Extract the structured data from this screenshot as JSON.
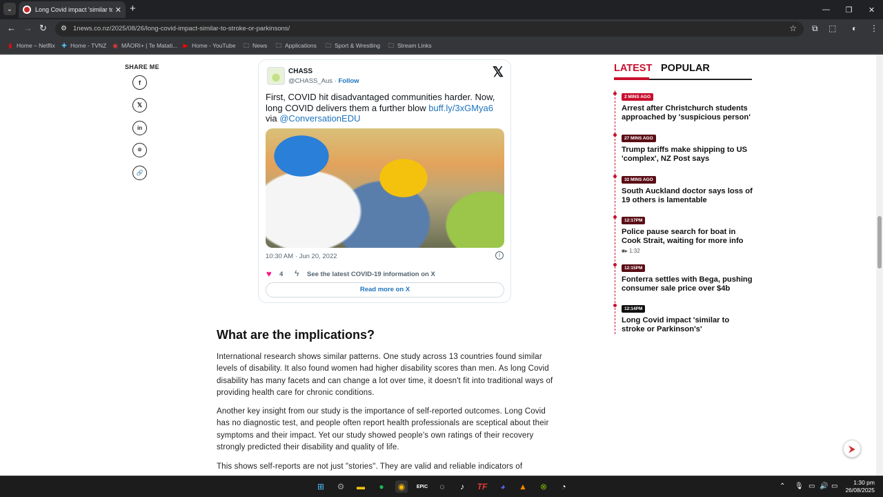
{
  "browser": {
    "tab_title": "Long Covid impact 'similar to stroke or Parkinson's'",
    "url": "1news.co.nz/2025/08/26/long-covid-impact-similar-to-stroke-or-parkinsons/",
    "bookmarks": [
      "Home – Netflix",
      "Home - TVNZ",
      "MĀORI+ | Te Matati...",
      "Home - YouTube",
      "News",
      "Applications",
      "Sport & Wrestling",
      "Stream Links"
    ]
  },
  "share": {
    "title": "SHARE ME",
    "buttons": [
      "f",
      "𝕏",
      "in",
      "⌾",
      "🔗"
    ]
  },
  "tweet": {
    "name": "CHASS",
    "handle": "@CHASS_Aus",
    "follow": "Follow",
    "x_logo": "𝕏",
    "text_before": "First, COVID hit disadvantaged communities harder. Now, long COVID delivers them a further blow ",
    "link": "buff.ly/3xGMya6",
    "text_via": " via ",
    "mention": "@ConversationEDU",
    "time": "10:30 AM · Jun 20, 2022",
    "likes": "4",
    "see_latest": "See the latest COVID-19 information on X",
    "read_more": "Read more on X"
  },
  "article": {
    "heading": "What are the implications?",
    "paragraphs": [
      "International research shows similar patterns. One study across 13 countries found similar levels of disability. It also found women had higher disability scores than men. As long Covid disability has many facets and can change a lot over time, it doesn't fit into traditional ways of providing health care for chronic conditions.",
      "Another key insight from our study is the importance of self-reported outcomes. Long Covid has no diagnostic test, and people often report health professionals are sceptical about their symptoms and their impact. Yet our study showed people's own ratings of their recovery strongly predicted their disability and quality of life.",
      "This shows self-reports are not just \"stories\". They are valid and reliable indicators of"
    ]
  },
  "sidebar": {
    "tab_latest": "LATEST",
    "tab_popular": "POPULAR",
    "items": [
      {
        "badge": "2 MINS AGO",
        "title": "Arrest after Christchurch students approached by 'suspicious person'"
      },
      {
        "badge": "27 MINS AGO",
        "title": "Trump tariffs make shipping to US 'complex', NZ Post says"
      },
      {
        "badge": "32 MINS AGO",
        "title": "South Auckland doctor says loss of 19 others is lamentable"
      },
      {
        "badge": "12:17PM",
        "title": "Police pause search for boat in Cook Strait, waiting for more info",
        "video": "1:32"
      },
      {
        "badge": "12:15PM",
        "title": "Fonterra settles with Bega, pushing consumer sale price over $4b"
      },
      {
        "badge": "12:14PM",
        "title": "Long Covid impact 'similar to stroke or Parkinson's'"
      }
    ]
  },
  "taskbar": {
    "time": "1:30 pm",
    "date": "26/08/2025"
  }
}
